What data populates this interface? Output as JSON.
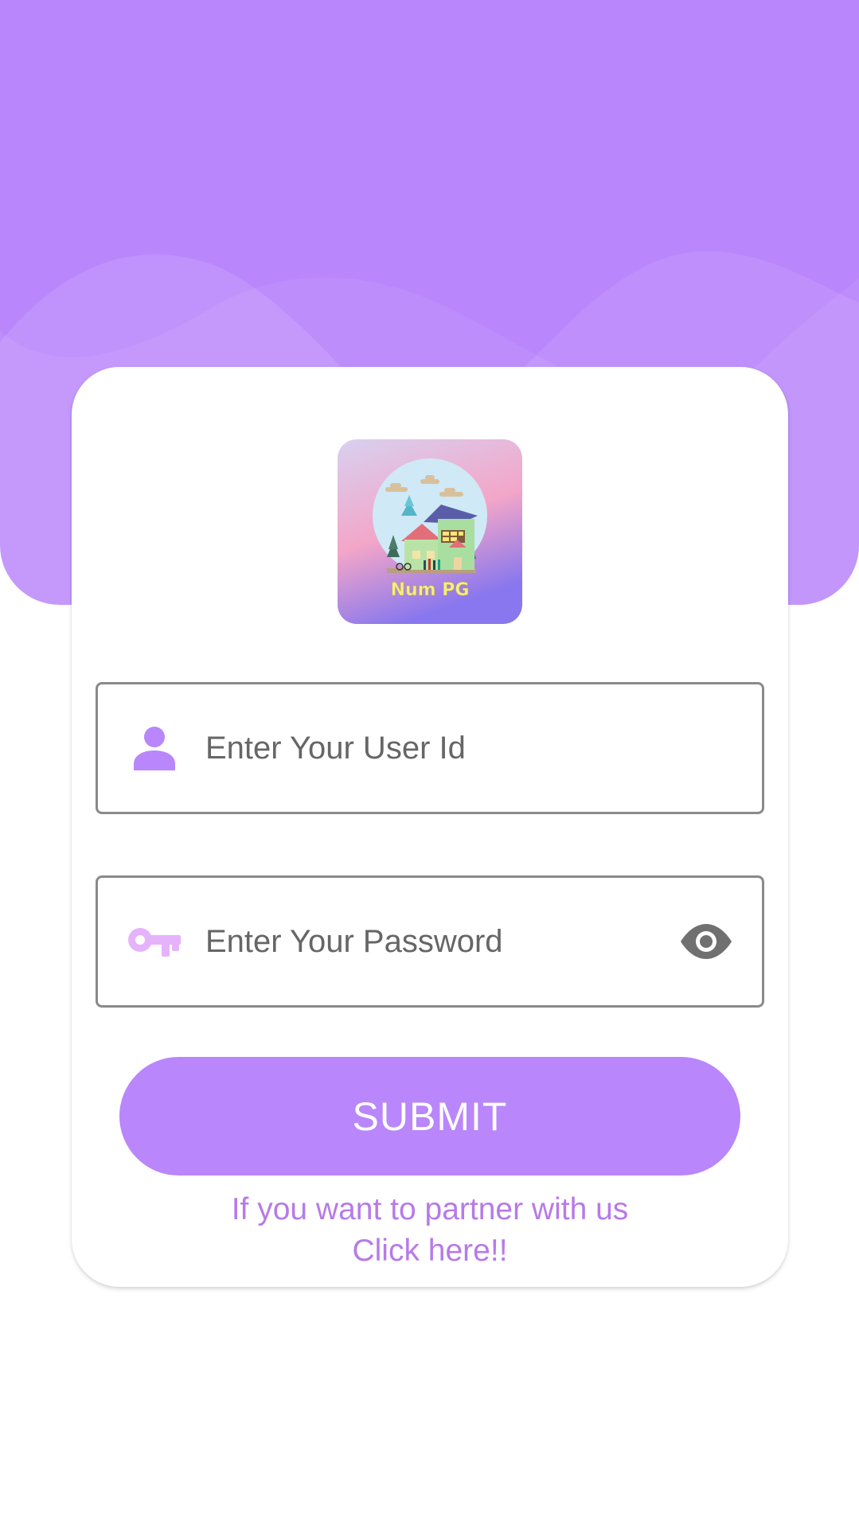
{
  "colors": {
    "accent": "#b986fb",
    "link": "#b77ae8",
    "field_border": "#8a8a8a",
    "key_icon": "#e5b3fb",
    "eye_icon": "#707070"
  },
  "logo": {
    "text": "Num PG"
  },
  "login": {
    "user_id_placeholder": "Enter Your User Id",
    "user_icon": "person-icon",
    "password_placeholder": "Enter Your Password",
    "password_icon": "key-icon",
    "visibility_icon": "eye-icon",
    "submit_label": "SUBMIT"
  },
  "partner": {
    "line1": "If you want to partner with us",
    "line2": "Click here!!"
  }
}
